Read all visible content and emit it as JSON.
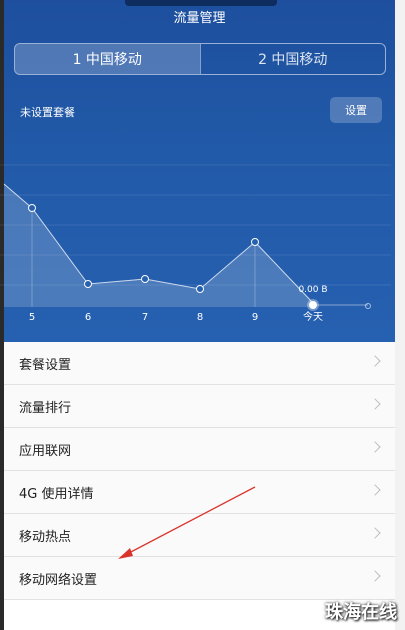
{
  "header": {
    "title": "流量管理",
    "sim_tabs": [
      {
        "label": "1 中国移动",
        "active": true
      },
      {
        "label": "2 中国移动",
        "active": false
      }
    ],
    "plan_status": "未设置套餐",
    "settings_label": "设置"
  },
  "chart_data": {
    "type": "line",
    "categories": [
      "5",
      "6",
      "7",
      "8",
      "9",
      "今天"
    ],
    "today_value_label": "0.00 B"
  },
  "menu": {
    "items": [
      {
        "label": "套餐设置"
      },
      {
        "label": "流量排行"
      },
      {
        "label": "应用联网"
      },
      {
        "label": "4G 使用详情"
      },
      {
        "label": "移动热点"
      },
      {
        "label": "移动网络设置"
      }
    ]
  },
  "watermark": "珠海在线",
  "colors": {
    "header_bg": "#215aa8",
    "annotation_arrow": "#d9342b"
  }
}
